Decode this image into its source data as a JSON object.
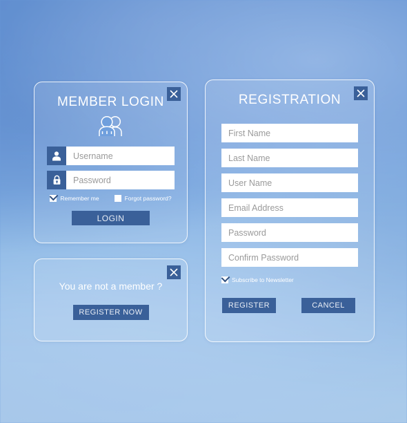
{
  "theme": {
    "accent": "#3a6099",
    "panel_border": "#ffffff",
    "text_on_dark": "#ffffff",
    "input_bg": "#ffffff",
    "placeholder_color": "#9a9a9a",
    "background_top": "#5c8ed4",
    "background_bottom": "#b6d6f2"
  },
  "login_panel": {
    "title": "MEMBER LOGIN",
    "avatar_icon": "members-icon",
    "close_icon": "close-icon",
    "fields": [
      {
        "name": "username",
        "icon": "user-icon",
        "placeholder": "Username",
        "value": ""
      },
      {
        "name": "password",
        "icon": "lock-icon",
        "placeholder": "Password",
        "value": ""
      }
    ],
    "options": [
      {
        "label": "Remember me",
        "checked": true
      },
      {
        "label": "Forgot password?",
        "checked": false
      }
    ],
    "submit_label": "LOGIN"
  },
  "not_member_panel": {
    "message": "You are not a member ?",
    "button_label": "REGISTER NOW",
    "close_icon": "close-icon"
  },
  "registration_panel": {
    "title": "REGISTRATION",
    "close_icon": "close-icon",
    "fields": [
      {
        "name": "first-name",
        "placeholder": "First Name",
        "value": ""
      },
      {
        "name": "last-name",
        "placeholder": "Last Name",
        "value": ""
      },
      {
        "name": "user-name",
        "placeholder": "User Name",
        "value": ""
      },
      {
        "name": "email-address",
        "placeholder": "Email Address",
        "value": ""
      },
      {
        "name": "password",
        "placeholder": "Password",
        "value": ""
      },
      {
        "name": "confirm-password",
        "placeholder": "Confirm Password",
        "value": ""
      }
    ],
    "newsletter": {
      "label": "Subscribe to Newsletter",
      "checked": true
    },
    "submit_label": "REGISTER",
    "cancel_label": "CANCEL"
  }
}
